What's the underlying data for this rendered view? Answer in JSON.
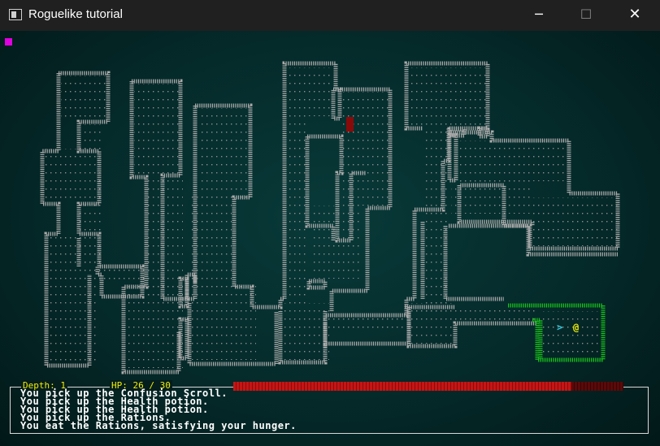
{
  "window": {
    "title": "Roguelike tutorial",
    "minimize_glyph": "─",
    "maximize_glyph": "☐",
    "close_glyph": "✕"
  },
  "status": {
    "depth_text": "Depth: 1",
    "hp_text": "HP: 26 / 30",
    "hp_current": 26,
    "hp_max": 30,
    "hp_bar_color": "#c41616"
  },
  "map": {
    "stairs_glyph": ">",
    "player_glyph": "@",
    "wall_color": "#a9a9a9",
    "visible_wall_color": "#19c419",
    "player_color": "#f0f000",
    "stairs_color": "#35c9dd"
  },
  "log": [
    "You pick up the Confusion Scroll.",
    "You pick up the Health potion.",
    "You pick up the Health potion.",
    "You pick up the Rations.",
    "You eat the Rations, satisfying your hunger."
  ]
}
